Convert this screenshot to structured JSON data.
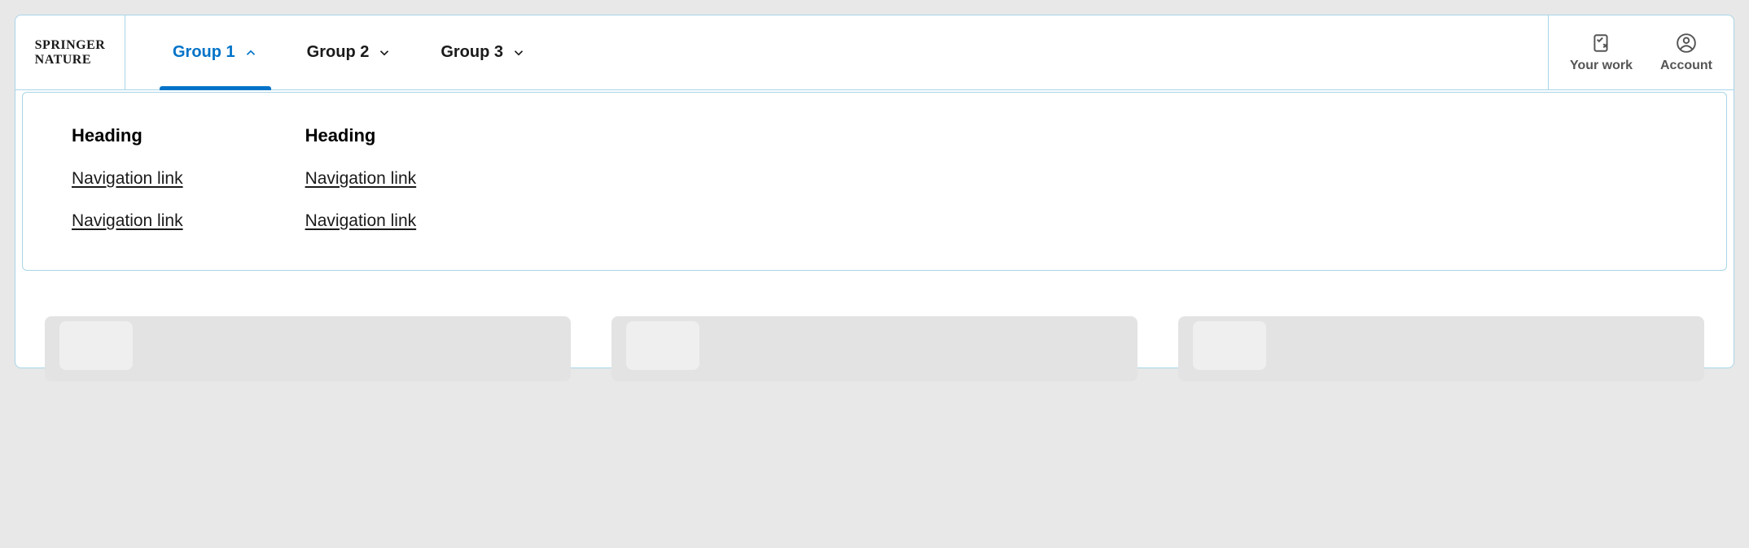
{
  "logo": {
    "line1": "Springer",
    "line2": "Nature"
  },
  "navTabs": [
    {
      "label": "Group 1",
      "active": true
    },
    {
      "label": "Group 2",
      "active": false
    },
    {
      "label": "Group 3",
      "active": false
    }
  ],
  "navRight": {
    "yourWork": "Your work",
    "account": "Account"
  },
  "dropdown": {
    "columns": [
      {
        "heading": "Heading",
        "links": [
          "Navigation link",
          "Navigation link"
        ]
      },
      {
        "heading": "Heading",
        "links": [
          "Navigation link",
          "Navigation link"
        ]
      }
    ]
  }
}
